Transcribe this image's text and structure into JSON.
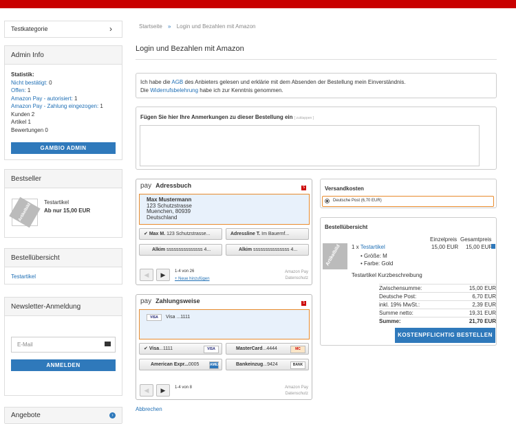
{
  "sidebar": {
    "category_label": "Testkategorie",
    "admin": {
      "title": "Admin Info",
      "stat_label": "Statistik:",
      "lines": [
        {
          "link": "Nicht bestätigt:",
          "value": " 0"
        },
        {
          "link": "Offen:",
          "value": " 1"
        },
        {
          "link": "Amazon Pay - autorisiert:",
          "value": " 1"
        },
        {
          "link": "Amazon Pay - Zahlung eingezogen:",
          "value": " 1"
        }
      ],
      "plain": [
        "Kunden 2",
        "Artikel 1",
        "Bewertungen 0"
      ],
      "button": "GAMBIO ADMIN"
    },
    "bestseller": {
      "title": "Bestseller",
      "img_label": "Artikelbild",
      "product": "Testartikel",
      "price": "Ab nur 15,00 EUR"
    },
    "overview": {
      "title": "Bestellübersicht",
      "item": "Testartikel"
    },
    "newsletter": {
      "title": "Newsletter-Anmeldung",
      "placeholder": "E-Mail",
      "button": "ANMELDEN"
    },
    "offers": {
      "title": "Angebote"
    }
  },
  "breadcrumb": {
    "home": "Startseite",
    "sep": "»",
    "current": "Login und Bezahlen mit Amazon"
  },
  "page_title": "Login und Bezahlen mit Amazon",
  "terms": {
    "line1_pre": "Ich habe die ",
    "agb": "AGB",
    "line1_post": " des Anbieters gelesen und erklärie mit dem Absenden der Bestellung mein Einverständnis.",
    "line2_pre": "Die ",
    "widerruf": "Widerrufsbelehrung",
    "line2_post": " habe ich zur Kenntnis genommen."
  },
  "comments": {
    "label": "Fügen Sie hier Ihre Anmerkungen zu dieser Bestellung ein",
    "hint": "[ zuklappen ]"
  },
  "address": {
    "pay": "pay",
    "title": "Adressbuch",
    "badge": "S",
    "name": "Max Mustermann",
    "street": "123 Schutzstrasse",
    "city": "Muenchen, 80939",
    "country": "Deutschland",
    "options": [
      {
        "bold": "Max M.",
        "rest": " 123 Schutzstrasse..."
      },
      {
        "bold": "Adressline T.",
        "rest": " Im Bauernf..."
      },
      {
        "bold": "Alkim",
        "rest": " sssssssssssssss 4..."
      },
      {
        "bold": "Alkim",
        "rest": " sssssssssssssss 4..."
      }
    ],
    "range": "1-4 von 26",
    "new": "+ Neue hinzufügen",
    "footer1": "Amazon Pay",
    "footer2": "Datenschutz",
    "prev": "◀",
    "next": "▶",
    "check": "✔"
  },
  "payment": {
    "pay": "pay",
    "title": "Zahlungsweise",
    "badge": "S",
    "card_logo": "VISA",
    "selected": "Visa ...1111",
    "options": [
      {
        "bold": "Visa",
        "rest": "...1111",
        "logo": "VISA"
      },
      {
        "bold": "MasterCard",
        "rest": "...4444",
        "logo": "MC"
      },
      {
        "bold": "American Expr...",
        "rest": "0005",
        "logo": "AMEX"
      },
      {
        "bold": "Bankeinzug",
        "rest": "...9424",
        "logo": "BANK"
      }
    ],
    "range": "1-4 von 8",
    "footer1": "Amazon Pay",
    "footer2": "Datenschutz",
    "prev": "◀",
    "next": "▶",
    "check": "✔"
  },
  "cancel": "Abbrechen",
  "shipping": {
    "title": "Versandkosten",
    "option": "Deutsche Post (6,70 EUR)"
  },
  "summary": {
    "title": "Bestellübersicht",
    "col_unit": "Einzelpreis",
    "col_total": "Gesamtpreis",
    "img_label": "Artikelbild",
    "qty": "1 x ",
    "product": "Testartikel",
    "unit": "15,00 EUR",
    "total": "15,00 EUR",
    "attrs": [
      "Größe: M",
      "Farbe: Gold"
    ],
    "desc": "Testartikel Kurzbeschreibung",
    "totals": [
      {
        "label": "Zwischensumme:",
        "value": "15,00 EUR"
      },
      {
        "label": "Deutsche Post:",
        "value": "6,70 EUR"
      },
      {
        "label": "inkl. 19% MwSt.:",
        "value": "2,39 EUR"
      },
      {
        "label": "Summe netto:",
        "value": "19,31 EUR"
      },
      {
        "label": "Summe:",
        "value": "21,70 EUR"
      }
    ],
    "button": "KOSTENPFLICHTIG BESTELLEN"
  }
}
